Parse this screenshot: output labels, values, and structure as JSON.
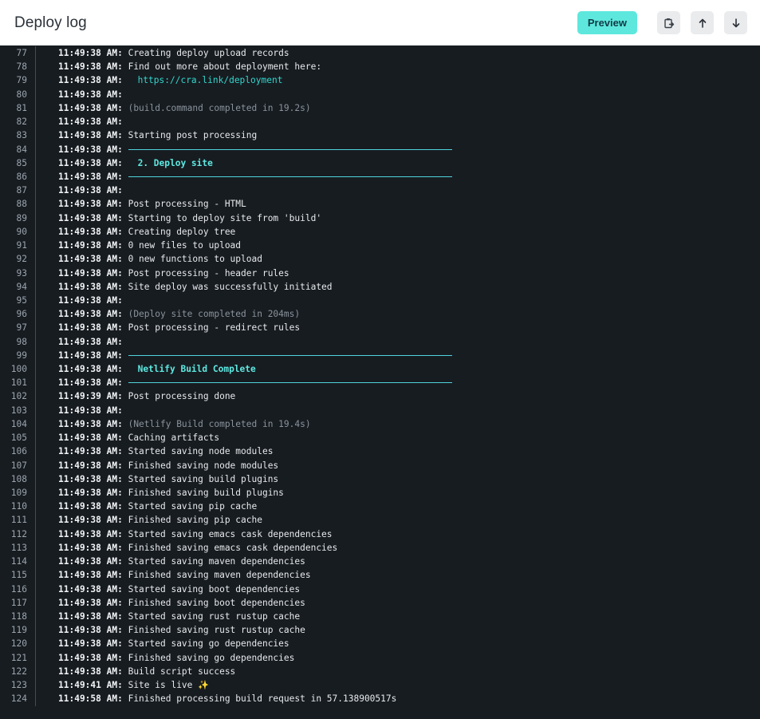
{
  "header": {
    "title": "Deploy log",
    "preview_label": "Preview",
    "icons": [
      "copy-clipboard-icon",
      "arrow-up-icon",
      "arrow-down-icon"
    ]
  },
  "colors": {
    "accent": "#5ee8dd",
    "log_bg": "#171c21",
    "link": "#32d6cc",
    "heading": "#5ee8e0",
    "rule": "#4fd4dc",
    "dim": "#8a939c"
  },
  "log": [
    {
      "n": "77",
      "t": "11:49:38 AM:",
      "m": "Creating deploy upload records",
      "k": "text"
    },
    {
      "n": "78",
      "t": "11:49:38 AM:",
      "m": "Find out more about deployment here:",
      "k": "text"
    },
    {
      "n": "79",
      "t": "11:49:38 AM:",
      "m": "https://cra.link/deployment",
      "k": "link"
    },
    {
      "n": "80",
      "t": "11:49:38 AM:",
      "m": "",
      "k": "text"
    },
    {
      "n": "81",
      "t": "11:49:38 AM:",
      "m": "(build.command completed in 19.2s)",
      "k": "dim"
    },
    {
      "n": "82",
      "t": "11:49:38 AM:",
      "m": "",
      "k": "text"
    },
    {
      "n": "83",
      "t": "11:49:38 AM:",
      "m": "Starting post processing",
      "k": "text"
    },
    {
      "n": "84",
      "t": "11:49:38 AM:",
      "m": "",
      "k": "rule"
    },
    {
      "n": "85",
      "t": "11:49:38 AM:",
      "m": "2. Deploy site",
      "k": "head"
    },
    {
      "n": "86",
      "t": "11:49:38 AM:",
      "m": "",
      "k": "rule"
    },
    {
      "n": "87",
      "t": "11:49:38 AM:",
      "m": "",
      "k": "text"
    },
    {
      "n": "88",
      "t": "11:49:38 AM:",
      "m": "Post processing - HTML",
      "k": "text"
    },
    {
      "n": "89",
      "t": "11:49:38 AM:",
      "m": "Starting to deploy site from 'build'",
      "k": "text"
    },
    {
      "n": "90",
      "t": "11:49:38 AM:",
      "m": "Creating deploy tree",
      "k": "text"
    },
    {
      "n": "91",
      "t": "11:49:38 AM:",
      "m": "0 new files to upload",
      "k": "text"
    },
    {
      "n": "92",
      "t": "11:49:38 AM:",
      "m": "0 new functions to upload",
      "k": "text"
    },
    {
      "n": "93",
      "t": "11:49:38 AM:",
      "m": "Post processing - header rules",
      "k": "text"
    },
    {
      "n": "94",
      "t": "11:49:38 AM:",
      "m": "Site deploy was successfully initiated",
      "k": "text"
    },
    {
      "n": "95",
      "t": "11:49:38 AM:",
      "m": "",
      "k": "text"
    },
    {
      "n": "96",
      "t": "11:49:38 AM:",
      "m": "(Deploy site completed in 204ms)",
      "k": "dim"
    },
    {
      "n": "97",
      "t": "11:49:38 AM:",
      "m": "Post processing - redirect rules",
      "k": "text"
    },
    {
      "n": "98",
      "t": "11:49:38 AM:",
      "m": "",
      "k": "text"
    },
    {
      "n": "99",
      "t": "11:49:38 AM:",
      "m": "",
      "k": "rule"
    },
    {
      "n": "100",
      "t": "11:49:38 AM:",
      "m": "Netlify Build Complete",
      "k": "head"
    },
    {
      "n": "101",
      "t": "11:49:38 AM:",
      "m": "",
      "k": "rule"
    },
    {
      "n": "102",
      "t": "11:49:39 AM:",
      "m": "Post processing done",
      "k": "text"
    },
    {
      "n": "103",
      "t": "11:49:38 AM:",
      "m": "",
      "k": "text"
    },
    {
      "n": "104",
      "t": "11:49:38 AM:",
      "m": "(Netlify Build completed in 19.4s)",
      "k": "dim"
    },
    {
      "n": "105",
      "t": "11:49:38 AM:",
      "m": "Caching artifacts",
      "k": "text"
    },
    {
      "n": "106",
      "t": "11:49:38 AM:",
      "m": "Started saving node modules",
      "k": "text"
    },
    {
      "n": "107",
      "t": "11:49:38 AM:",
      "m": "Finished saving node modules",
      "k": "text"
    },
    {
      "n": "108",
      "t": "11:49:38 AM:",
      "m": "Started saving build plugins",
      "k": "text"
    },
    {
      "n": "109",
      "t": "11:49:38 AM:",
      "m": "Finished saving build plugins",
      "k": "text"
    },
    {
      "n": "110",
      "t": "11:49:38 AM:",
      "m": "Started saving pip cache",
      "k": "text"
    },
    {
      "n": "111",
      "t": "11:49:38 AM:",
      "m": "Finished saving pip cache",
      "k": "text"
    },
    {
      "n": "112",
      "t": "11:49:38 AM:",
      "m": "Started saving emacs cask dependencies",
      "k": "text"
    },
    {
      "n": "113",
      "t": "11:49:38 AM:",
      "m": "Finished saving emacs cask dependencies",
      "k": "text"
    },
    {
      "n": "114",
      "t": "11:49:38 AM:",
      "m": "Started saving maven dependencies",
      "k": "text"
    },
    {
      "n": "115",
      "t": "11:49:38 AM:",
      "m": "Finished saving maven dependencies",
      "k": "text"
    },
    {
      "n": "116",
      "t": "11:49:38 AM:",
      "m": "Started saving boot dependencies",
      "k": "text"
    },
    {
      "n": "117",
      "t": "11:49:38 AM:",
      "m": "Finished saving boot dependencies",
      "k": "text"
    },
    {
      "n": "118",
      "t": "11:49:38 AM:",
      "m": "Started saving rust rustup cache",
      "k": "text"
    },
    {
      "n": "119",
      "t": "11:49:38 AM:",
      "m": "Finished saving rust rustup cache",
      "k": "text"
    },
    {
      "n": "120",
      "t": "11:49:38 AM:",
      "m": "Started saving go dependencies",
      "k": "text"
    },
    {
      "n": "121",
      "t": "11:49:38 AM:",
      "m": "Finished saving go dependencies",
      "k": "text"
    },
    {
      "n": "122",
      "t": "11:49:38 AM:",
      "m": "Build script success",
      "k": "text"
    },
    {
      "n": "123",
      "t": "11:49:41 AM:",
      "m": "Site is live ✨",
      "k": "text"
    },
    {
      "n": "124",
      "t": "11:49:58 AM:",
      "m": "Finished processing build request in 57.138900517s",
      "k": "text"
    }
  ]
}
